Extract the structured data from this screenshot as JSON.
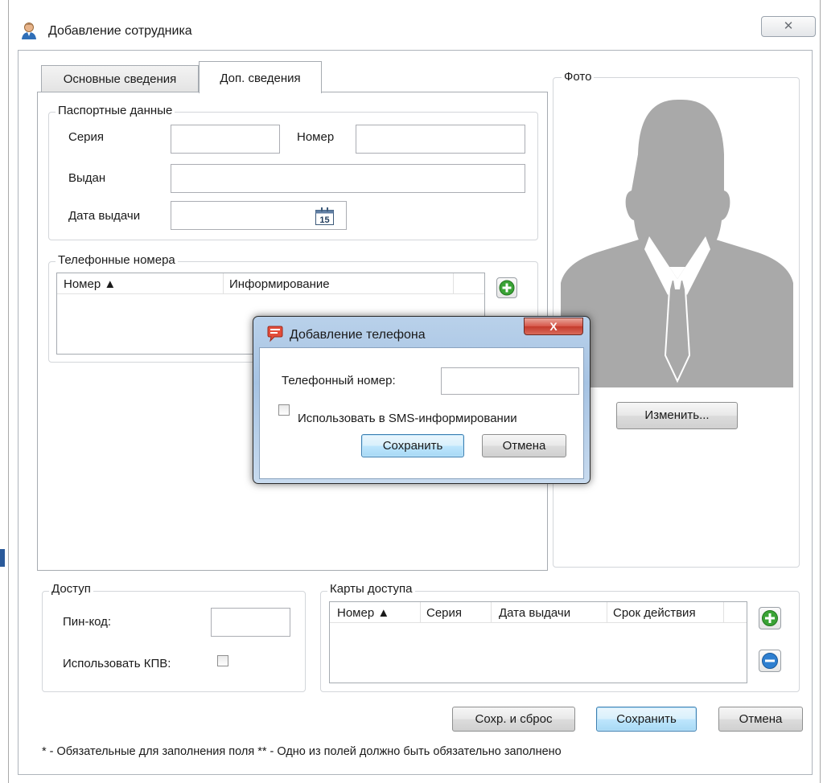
{
  "window": {
    "title": "Добавление сотрудника",
    "close_glyph": "✕"
  },
  "tabs": [
    {
      "label": "Основные сведения",
      "active": false
    },
    {
      "label": "Доп. сведения",
      "active": true
    }
  ],
  "passport": {
    "legend": "Паспортные данные",
    "series_label": "Серия",
    "series_value": "",
    "number_label": "Номер",
    "number_value": "",
    "issued_by_label": "Выдан",
    "issued_by_value": "",
    "issue_date_label": "Дата выдачи",
    "issue_date_value": "",
    "calendar_day": "15"
  },
  "phones": {
    "legend": "Телефонные номера",
    "columns": [
      "Номер ▲",
      "Информирование"
    ],
    "rows": []
  },
  "photo": {
    "legend": "Фото",
    "change_button": "Изменить..."
  },
  "access": {
    "legend": "Доступ",
    "pin_label": "Пин-код:",
    "pin_value": "",
    "kpv_label": "Использовать КПВ:",
    "kpv_checked": false
  },
  "cards": {
    "legend": "Карты доступа",
    "columns": [
      "Номер ▲",
      "Серия",
      "Дата выдачи",
      "Срок действия"
    ],
    "rows": []
  },
  "buttons": {
    "save_reset": "Сохр. и сброс",
    "save": "Сохранить",
    "cancel": "Отмена"
  },
  "footnote": "* - Обязательные для заполнения поля ** - Одно из полей должно быть обязательно заполнено",
  "phone_dialog": {
    "title": "Добавление телефона",
    "close_glyph": "X",
    "phone_label": "Телефонный номер:",
    "phone_value": "",
    "sms_label": "Использовать в SMS-информировании",
    "sms_checked": false,
    "save": "Сохранить",
    "cancel": "Отмена"
  },
  "colors": {
    "silhouette": "#a9a9a9",
    "add_green": "#3aa335",
    "remove_blue": "#2e7fd0",
    "default_button": "#3c7fb1"
  },
  "icons": [
    "person-icon",
    "close-icon",
    "calendar-icon",
    "add-icon",
    "remove-icon",
    "sms-icon",
    "sort-asc-icon"
  ]
}
